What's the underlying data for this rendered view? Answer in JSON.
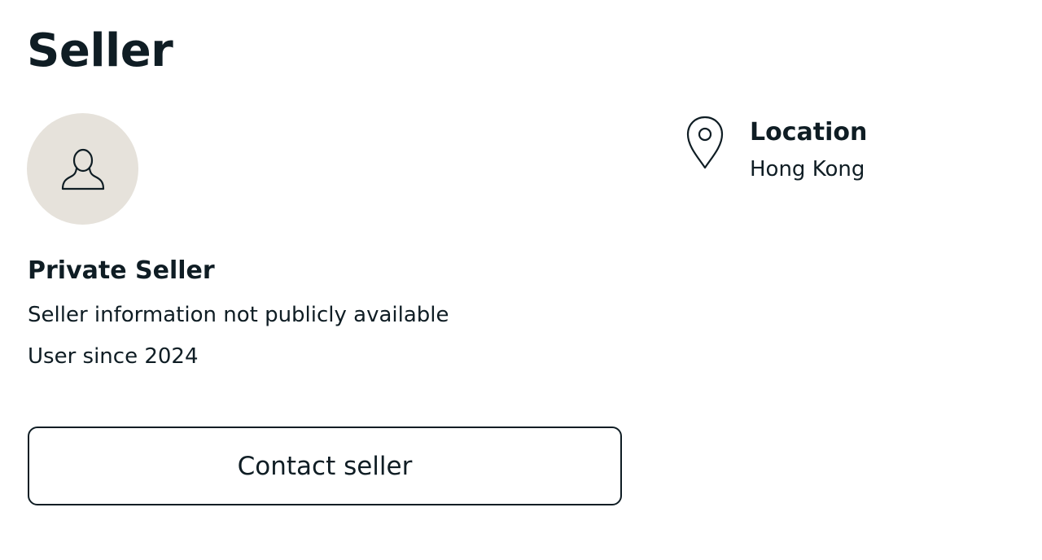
{
  "section": {
    "title": "Seller"
  },
  "seller": {
    "avatar_icon": "user-silhouette-icon",
    "avatar_bg_color": "#e6e2db",
    "name": "Private Seller",
    "info": "Seller information not publicly available",
    "member_since": "User since 2024"
  },
  "contact": {
    "button_label": "Contact seller"
  },
  "location": {
    "icon": "map-pin-icon",
    "label": "Location",
    "value": "Hong Kong"
  },
  "colors": {
    "text": "#0f1d24",
    "background": "#ffffff"
  }
}
